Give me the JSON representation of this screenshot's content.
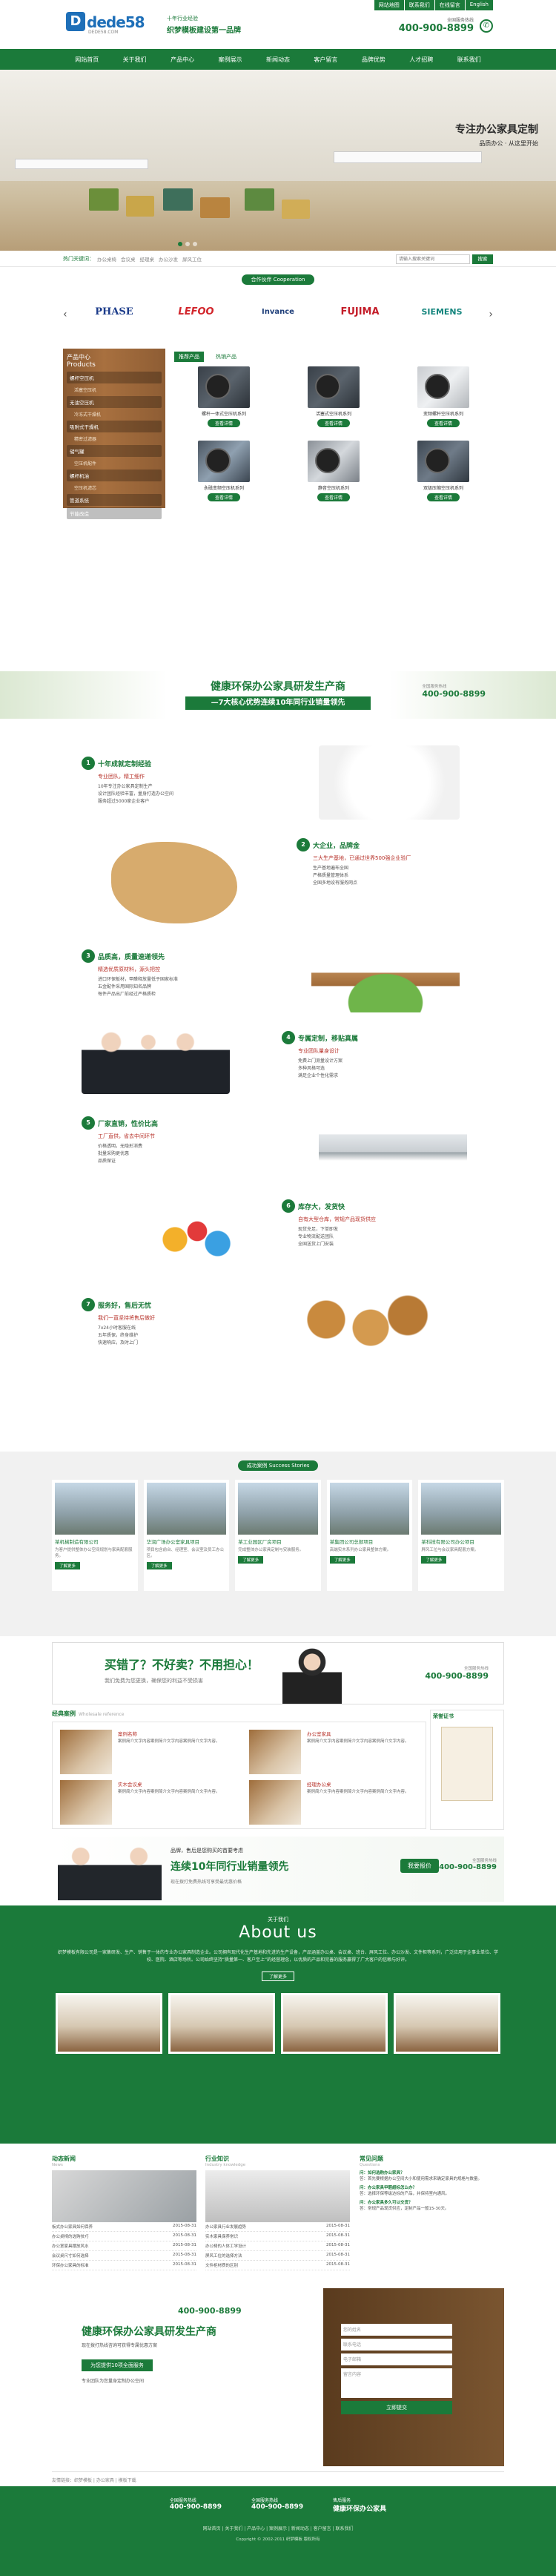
{
  "header": {
    "logo_text": "dede58",
    "logo_sub": "DEDE58.COM",
    "slogan_small": "十年行业经验",
    "slogan_main": "织梦模板建设第一品牌",
    "top_links": [
      "网站地图",
      "联系我们",
      "在线留言",
      "English"
    ],
    "hotline_label": "全国服务热线",
    "hotline": "400-900-8899"
  },
  "nav": [
    "网站首页",
    "关于我们",
    "产品中心",
    "案例展示",
    "新闻动态",
    "客户留言",
    "品牌优势",
    "人才招聘",
    "联系我们"
  ],
  "banner": {
    "title": "专注办公家具定制",
    "subtitle": "品质办公 · 从这里开始"
  },
  "search": {
    "hot_label": "热门关键词：",
    "hot_words": [
      "办公桌椅",
      "会议桌",
      "经理桌",
      "办公沙发",
      "屏风工位"
    ],
    "placeholder": "请输入搜索关键词",
    "button": "搜索"
  },
  "coop": {
    "tag": "合作伙伴 Cooperation",
    "brands": [
      "PHASE",
      "LEFOO",
      "Invance",
      "FUJIMA",
      "SIEMENS"
    ]
  },
  "products": {
    "side_title_cn": "产品中心",
    "side_title_en": "Products",
    "categories": [
      "螺杆空压机",
      "活塞空压机",
      "无油空压机",
      "冷冻式干燥机",
      "吸附式干燥机",
      "精密过滤器",
      "储气罐",
      "空压机配件",
      "螺杆机油",
      "空压机滤芯",
      "管道系统",
      "节能改造"
    ],
    "tabs": [
      "推荐产品",
      "热销产品"
    ],
    "items": [
      {
        "name": "螺杆一体式空压机系列"
      },
      {
        "name": "活塞式空压机系列"
      },
      {
        "name": "变频螺杆空压机系列"
      },
      {
        "name": "永磁变频空压机系列"
      },
      {
        "name": "静音空压机系列"
      },
      {
        "name": "双级压缩空压机系列"
      }
    ],
    "detail_btn": "查看详情"
  },
  "advantage": {
    "title": "健康环保办公家具研发生产商",
    "subtitle": "—7大核心优势连续10年同行业销量领先",
    "phone_label": "全国服务热线",
    "phone": "400-900-8899",
    "blocks": [
      {
        "n": "1",
        "title": "十年成就定制经验",
        "sub": "专业团队，精工细作",
        "lines": [
          "10年专注办公家具定制生产",
          "设计团队经验丰富，量身打造办公空间",
          "服务超过5000家企业客户"
        ]
      },
      {
        "n": "2",
        "title": "大企业，品牌金",
        "sub": "三大生产基地，已通过世界500强企业验厂",
        "lines": [
          "生产基地遍布全国",
          "严格质量管理体系",
          "全国多地设有服务网点"
        ]
      },
      {
        "n": "3",
        "title": "品质高，质量速递领先",
        "sub": "精选优质原材料，源头把控",
        "lines": [
          "进口环保板材，甲醛释放量低于国家标准",
          "五金配件采用国际知名品牌",
          "每件产品出厂前经过严格质检"
        ]
      },
      {
        "n": "4",
        "title": "专属定制，移贴真属",
        "sub": "专业团队量身设计",
        "lines": [
          "免费上门测量设计方案",
          "多种风格可选",
          "满足企业个性化需求"
        ]
      },
      {
        "n": "5",
        "title": "厂家直销，性价比高",
        "sub": "工厂直供，省去中间环节",
        "lines": [
          "价格透明，无隐形消费",
          "批量采购更优惠",
          "品质保证"
        ]
      },
      {
        "n": "6",
        "title": "库存大，发货快",
        "sub": "自有大型仓库，常规产品现货供应",
        "lines": [
          "现货充足，下单即发",
          "专业物流配送团队",
          "全国送货上门安装"
        ]
      },
      {
        "n": "7",
        "title": "服务好，售后无忧",
        "sub": "我们一直坚持将售后做好",
        "lines": [
          "7x24小时客服在线",
          "五年质保，终身维护",
          "快速响应，及时上门"
        ]
      }
    ]
  },
  "success": {
    "tag": "成功案例 Success Stories",
    "items": [
      {
        "title": "某机械制造有限公司",
        "text": "为客户提供整体办公空间规划与家具配套服务。"
      },
      {
        "title": "华润广场办公室家具项目",
        "text": "项目包含前台、经理室、会议室及员工办公区。"
      },
      {
        "title": "某工业园区厂房项目",
        "text": "完成整体办公家具定制与安装服务。"
      },
      {
        "title": "某集团公司总部项目",
        "text": "高端实木系列办公家具整体方案。"
      },
      {
        "title": "某科技有限公司办公项目",
        "text": "屏风工位与会议家具配套方案。"
      }
    ],
    "more": "了解更多"
  },
  "buy": {
    "title": "买错了？不好卖？不用担心！",
    "text": "我们免费为您更换，确保您的利益不受损害",
    "phone_label": "全国服务热线",
    "phone": "400-900-8899"
  },
  "cases": {
    "title": "经典案例",
    "title_en": "Wholesale reference",
    "items": [
      {
        "title": "案例名称",
        "text": "案例简介文字内容案例简介文字内容案例简介文字内容。"
      },
      {
        "title": "办公室家具",
        "text": "案例简介文字内容案例简介文字内容案例简介文字内容。"
      },
      {
        "title": "实木会议桌",
        "text": "案例简介文字内容案例简介文字内容案例简介文字内容。"
      },
      {
        "title": "经理办公桌",
        "text": "案例简介文字内容案例简介文字内容案例简介文字内容。"
      }
    ],
    "cert_title": "荣誉证书"
  },
  "ban2": {
    "small": "品牌，售后是您购买的首要考虑",
    "main": "连续10年同行业销量领先",
    "sub": "现在拨打免费热线可享受最优惠价格",
    "btn": "我要报价",
    "phone_label": "全国服务热线",
    "phone": "400-900-8899"
  },
  "about": {
    "h1": "关于我们",
    "h2": "About us",
    "text": "织梦模板有限公司是一家集研发、生产、销售于一体的专业办公家具制造企业。公司拥有现代化生产基地和先进的生产设备，产品涵盖办公桌、会议桌、班台、屏风工位、办公沙发、文件柜等系列，广泛应用于企事业单位、学校、医院、酒店等场所。公司始终坚持“质量第一、客户至上”的经营理念，以优质的产品和完善的服务赢得了广大客户的信赖与好评。",
    "more": "了解更多"
  },
  "news": {
    "col1_title": "动态新闻",
    "col1_en": "News",
    "col2_title": "行业知识",
    "col2_en": "Industry knowledge",
    "col3_title": "常见问题",
    "col3_en": "Questions",
    "list1": [
      [
        "板式办公家具如何保养",
        "2015-08-31"
      ],
      [
        "办公桌椅的选购技巧",
        "2015-08-31"
      ],
      [
        "办公室家具摆放风水",
        "2015-08-31"
      ],
      [
        "会议桌尺寸如何选择",
        "2015-08-31"
      ],
      [
        "环保办公家具的标准",
        "2015-08-31"
      ]
    ],
    "list2": [
      [
        "办公家具行业发展趋势",
        "2015-08-31"
      ],
      [
        "实木家具保养常识",
        "2015-08-31"
      ],
      [
        "办公椅的人体工学设计",
        "2015-08-31"
      ],
      [
        "屏风工位的选择方法",
        "2015-08-31"
      ],
      [
        "文件柜材质的区别",
        "2015-08-31"
      ]
    ],
    "qa": [
      {
        "q": "问：如何选购办公家具？",
        "a": "答：首先要根据办公空间大小和使用需求来确定家具的规格与数量。"
      },
      {
        "q": "问：办公家具甲醛超标怎么办？",
        "a": "答：选择环保等级达标的产品，并保持室内通风。"
      },
      {
        "q": "问：办公家具多久可以交货？",
        "a": "答：常规产品现货供应，定制产品一般15-30天。"
      }
    ]
  },
  "foot1": {
    "title": "健康环保办公家具研发生产商",
    "text": "现在拨打热线咨询可获得专属优惠方案",
    "btn": "为您提供10项全面服务",
    "note": "专业团队为您量身定制办公空间",
    "phone": "400-900-8899",
    "fields": [
      "您的姓名",
      "联系电话",
      "电子邮箱",
      "留言内容"
    ],
    "submit": "立即提交"
  },
  "links": "友情链接：织梦模板 | 办公家具 | 模板下载",
  "footer": {
    "items": [
      {
        "l": "全国服务热线",
        "v": "400-900-8899"
      },
      {
        "l": "全国服务热线",
        "v": "400-900-8899"
      },
      {
        "l": "售后服务",
        "v": "健康环保办公家具"
      }
    ],
    "nav": "网站首页 | 关于我们 | 产品中心 | 案例展示 | 新闻动态 | 客户留言 | 联系我们",
    "copy": "Copyright © 2002-2011 织梦模板 版权所有"
  }
}
